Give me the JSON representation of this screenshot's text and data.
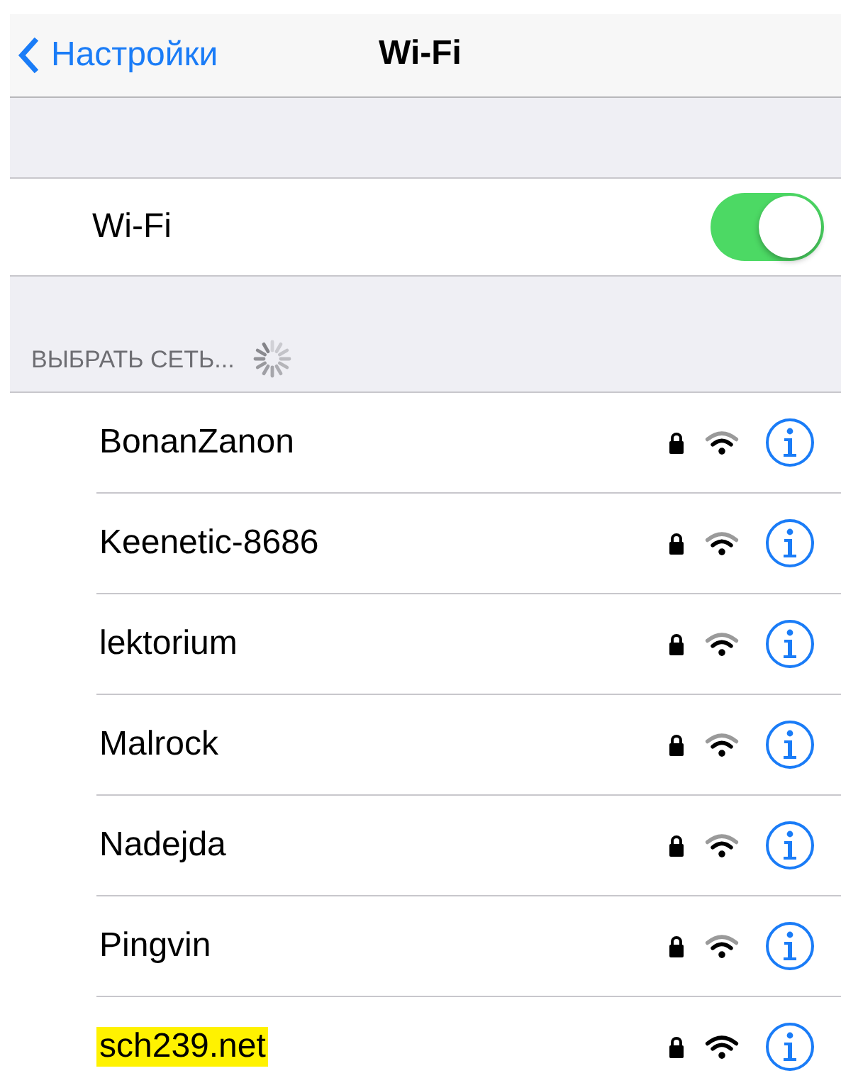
{
  "nav": {
    "back": "Настройки",
    "title": "Wi-Fi"
  },
  "wifi_row": {
    "label": "Wi-Fi",
    "on": true
  },
  "section": {
    "header": "ВЫБРАТЬ СЕТЬ...",
    "searching": true
  },
  "networks": [
    {
      "name": "BonanZanon",
      "locked": true,
      "full_signal": false,
      "highlighted": false
    },
    {
      "name": "Keenetic-8686",
      "locked": true,
      "full_signal": false,
      "highlighted": false
    },
    {
      "name": "lektorium",
      "locked": true,
      "full_signal": false,
      "highlighted": false
    },
    {
      "name": "Malrock",
      "locked": true,
      "full_signal": false,
      "highlighted": false
    },
    {
      "name": "Nadejda",
      "locked": true,
      "full_signal": false,
      "highlighted": false
    },
    {
      "name": "Pingvin",
      "locked": true,
      "full_signal": false,
      "highlighted": false
    },
    {
      "name": "sch239.net",
      "locked": true,
      "full_signal": true,
      "highlighted": true
    }
  ]
}
